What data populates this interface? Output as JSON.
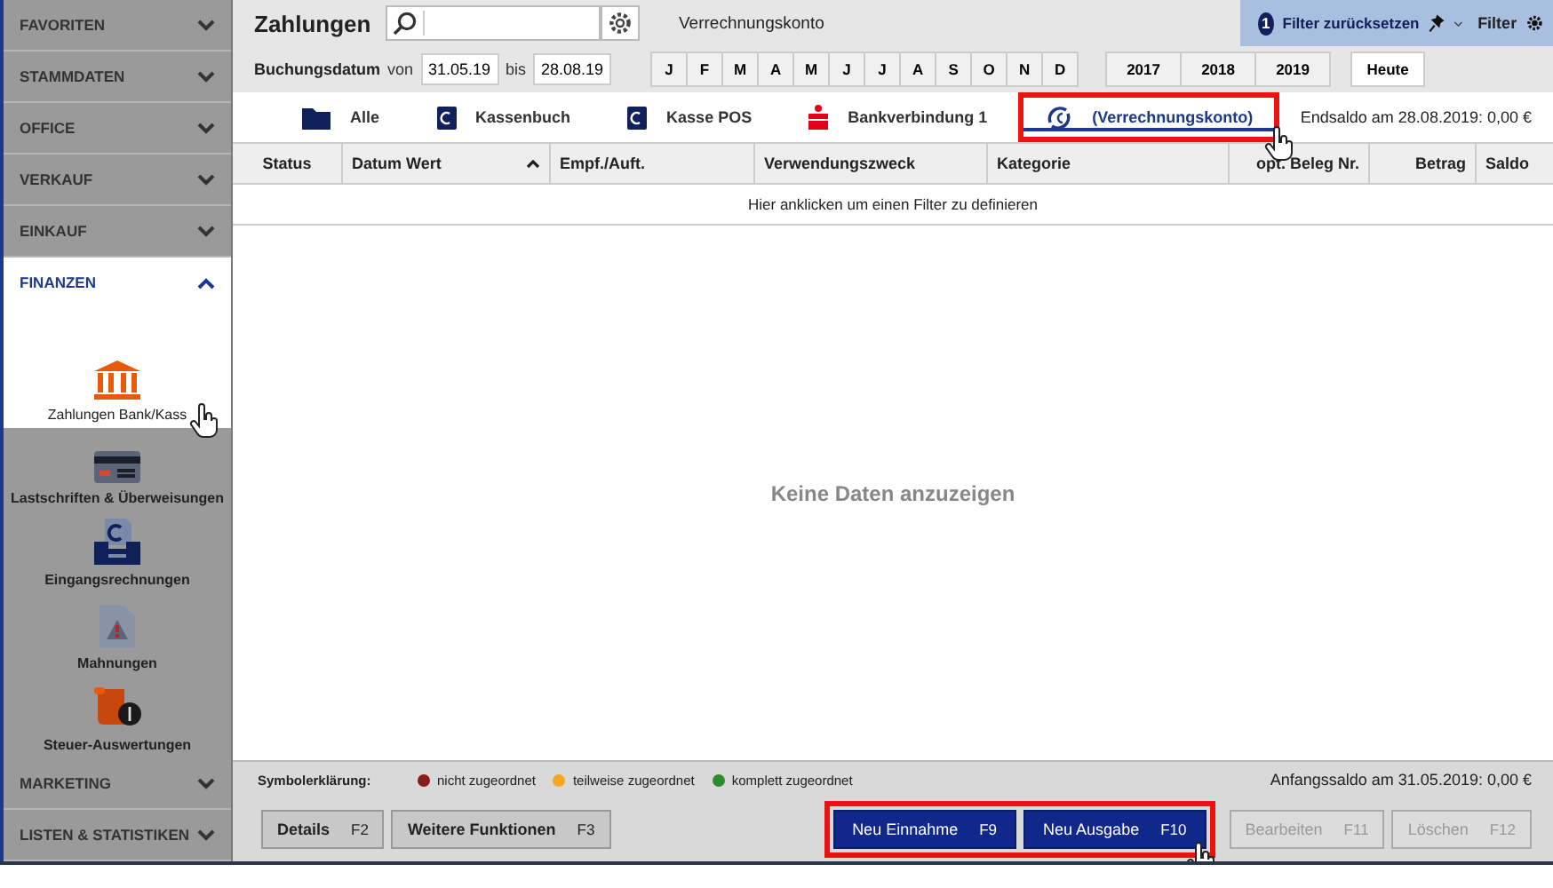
{
  "sidebar": {
    "sections": [
      {
        "label": "FAVORITEN",
        "expanded": false
      },
      {
        "label": "STAMMDATEN",
        "expanded": false
      },
      {
        "label": "OFFICE",
        "expanded": false
      },
      {
        "label": "VERKAUF",
        "expanded": false
      },
      {
        "label": "EINKAUF",
        "expanded": false
      },
      {
        "label": "FINANZEN",
        "expanded": true,
        "items": [
          {
            "label": "Zahlungen Bank/Kass",
            "kind": "bank",
            "selected": true
          },
          {
            "label": "Lastschriften & Überweisungen",
            "kind": "card",
            "selected": false
          },
          {
            "label": "Eingangsrechnungen",
            "kind": "inbox",
            "selected": false
          },
          {
            "label": "Mahnungen",
            "kind": "warning",
            "selected": false
          },
          {
            "label": "Steuer-Auswertungen",
            "kind": "scroll",
            "selected": false
          }
        ]
      },
      {
        "label": "MARKETING",
        "expanded": false
      },
      {
        "label": "LISTEN & STATISTIKEN",
        "expanded": false
      }
    ]
  },
  "toolbar": {
    "title": "Zahlungen",
    "account": "Verrechnungskonto",
    "filter_count": "1",
    "reset_label": "Filter zurücksetzen",
    "filter_label": "Filter"
  },
  "date_filter": {
    "label": "Buchungsdatum",
    "from_label": "von",
    "from": "31.05.19",
    "to_label": "bis",
    "to": "28.08.19",
    "months": [
      "J",
      "F",
      "M",
      "A",
      "M",
      "J",
      "J",
      "A",
      "S",
      "O",
      "N",
      "D"
    ],
    "years": [
      "2017",
      "2018",
      "2019"
    ],
    "today": "Heute"
  },
  "tabs": [
    {
      "label": "Alle",
      "kind": "folder",
      "selected": false,
      "highlighted": false
    },
    {
      "label": "Kassenbuch",
      "kind": "book",
      "selected": false,
      "highlighted": false
    },
    {
      "label": "Kasse POS",
      "kind": "book",
      "selected": false,
      "highlighted": false
    },
    {
      "label": "Bankverbindung 1",
      "kind": "bank",
      "selected": false,
      "highlighted": false
    },
    {
      "label": "(Verrechnungskonto)",
      "kind": "exchange",
      "selected": true,
      "highlighted": true
    }
  ],
  "end_balance": "Endsaldo am 28.08.2019: 0,00 €",
  "table": {
    "columns": [
      {
        "label": "Status",
        "sorted": false
      },
      {
        "label": "Datum Wert",
        "sorted": true
      },
      {
        "label": "Empf./Auft.",
        "sorted": false
      },
      {
        "label": "Verwendungszweck",
        "sorted": false
      },
      {
        "label": "Kategorie",
        "sorted": false
      },
      {
        "label": "opt. Beleg Nr.",
        "sorted": false
      },
      {
        "label": "Betrag",
        "sorted": false
      },
      {
        "label": "Saldo",
        "sorted": false
      }
    ],
    "filter_hint": "Hier anklicken um einen Filter zu definieren",
    "empty_message": "Keine Daten anzuzeigen"
  },
  "legend": {
    "label": "Symbolerklärung:",
    "items": [
      {
        "label": "nicht zugeordnet",
        "color": "#8b1a1a"
      },
      {
        "label": "teilweise zugeordnet",
        "color": "#f5a623"
      },
      {
        "label": "komplett zugeordnet",
        "color": "#2e8b2e"
      }
    ]
  },
  "start_balance": "Anfangssaldo am 31.05.2019: 0,00 €",
  "buttons": [
    {
      "label": "Details",
      "key": "F2",
      "kind": "plain",
      "disabled": false,
      "highlighted": false
    },
    {
      "label": "Weitere Funktionen",
      "key": "F3",
      "kind": "plain",
      "disabled": false,
      "highlighted": false
    },
    {
      "label": "Neu Einnahme",
      "key": "F9",
      "kind": "primary",
      "disabled": false,
      "highlighted": true
    },
    {
      "label": "Neu Ausgabe",
      "key": "F10",
      "kind": "primary",
      "disabled": false,
      "highlighted": true
    },
    {
      "label": "Bearbeiten",
      "key": "F11",
      "kind": "plain",
      "disabled": true,
      "highlighted": false
    },
    {
      "label": "Löschen",
      "key": "F12",
      "kind": "plain",
      "disabled": true,
      "highlighted": false
    }
  ]
}
